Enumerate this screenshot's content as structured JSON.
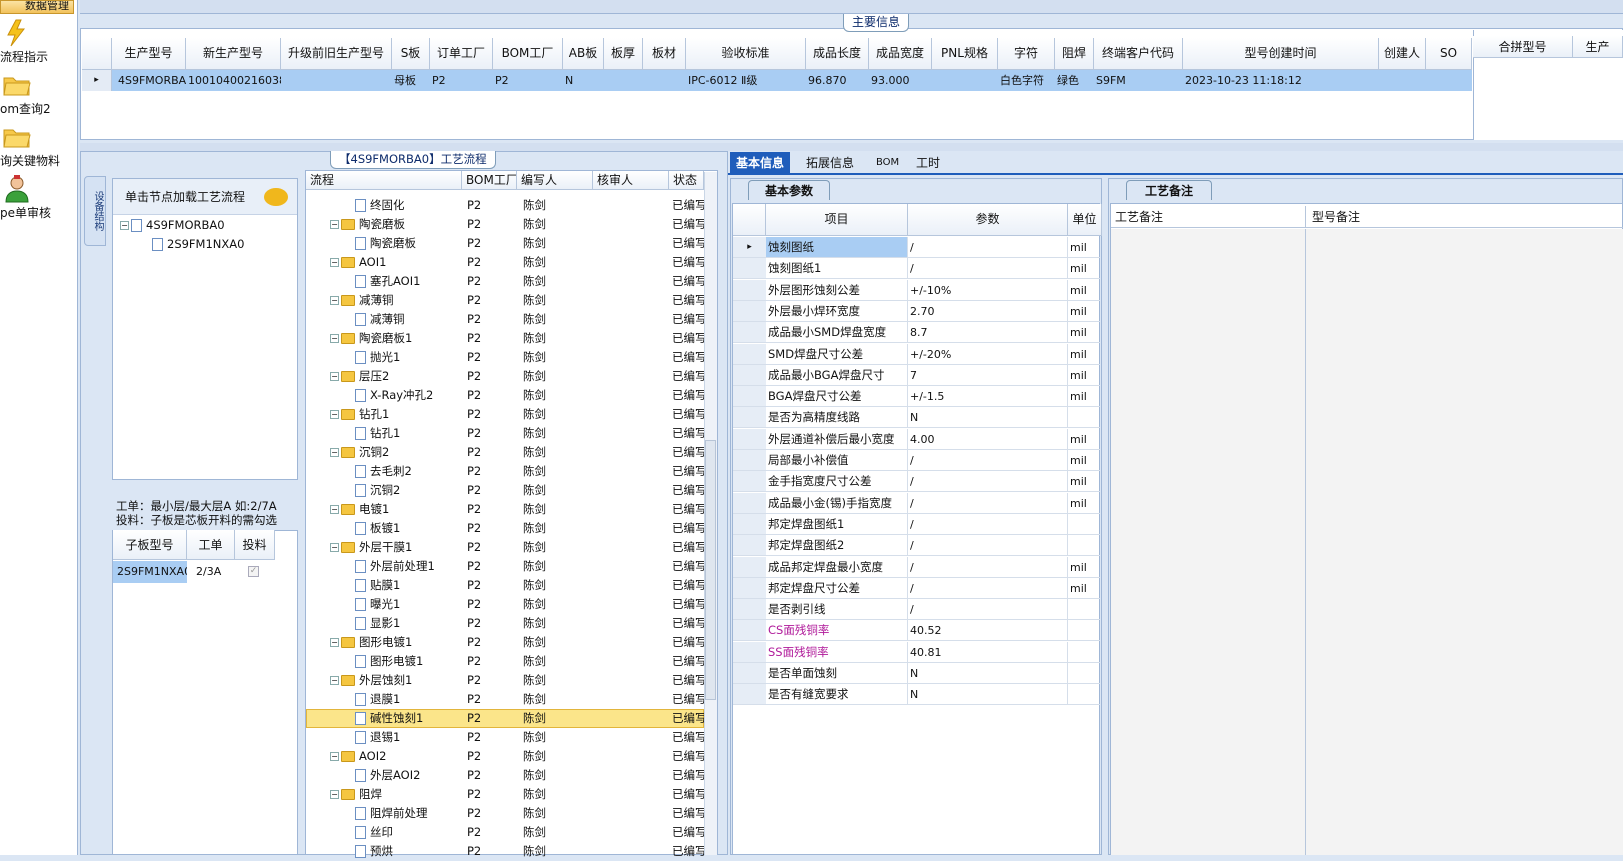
{
  "sidebar": {
    "header": "数据管理",
    "items": [
      {
        "label": "流程指示",
        "icon": "lightning-icon"
      },
      {
        "label": "om查询2",
        "icon": "folder-icon"
      },
      {
        "label": "询关键物料",
        "icon": "folder-icon"
      },
      {
        "label": "pe单审核",
        "icon": "user-icon"
      }
    ]
  },
  "main_info": {
    "title": "主要信息",
    "columns": [
      "生产型号",
      "新生产型号",
      "升级前旧生产型号",
      "S板",
      "订单工厂",
      "BOM工厂",
      "AB板",
      "板厚",
      "板材",
      "验收标准",
      "成品长度",
      "成品宽度",
      "PNL规格",
      "字符",
      "阻焊",
      "终端客户代码",
      "型号创建时间",
      "创建人",
      "SO"
    ],
    "row": {
      "prod_model": "4S9FMORBA0",
      "new_model": "10010400216038",
      "s_board": "母板",
      "order_factory": "P2",
      "bom_factory": "P2",
      "ab_board": "N",
      "standard": "IPC-6012 Ⅱ级",
      "length": "96.870",
      "width": "93.000",
      "char": "白色字符",
      "solder": "绿色",
      "customer": "S9FM",
      "created": "2023-10-23 11:18:12"
    },
    "right_columns": [
      "合拼型号",
      "生产"
    ]
  },
  "flow": {
    "title": "【4S9FMORBA0】工艺流程",
    "side_tab": "设备结构",
    "hint": "单击节点加载工艺流程",
    "tree": [
      "4S9FMORBA0",
      "2S9FM1NXA0"
    ],
    "note1": "工单：最小层/最大层A 如:2/7A",
    "note2": "投料：子板是芯板开料的需勾选",
    "sub_headers": [
      "子板型号",
      "工单",
      "投料"
    ],
    "sub_row": {
      "model": "2S9FM1NXA0",
      "order": "2/3A"
    },
    "cols": [
      "流程",
      "BOM工厂",
      "编写人",
      "核审人",
      "状态"
    ],
    "steps": [
      {
        "name": "终固化",
        "f": "P2",
        "w": "陈剑",
        "st": "已编写",
        "lvl": 2
      },
      {
        "name": "陶瓷磨板",
        "f": "P2",
        "w": "陈剑",
        "st": "已编写",
        "lvl": 1
      },
      {
        "name": "陶瓷磨板",
        "f": "P2",
        "w": "陈剑",
        "st": "已编写",
        "lvl": 2
      },
      {
        "name": "AOI1",
        "f": "P2",
        "w": "陈剑",
        "st": "已编写",
        "lvl": 1
      },
      {
        "name": "塞孔AOI1",
        "f": "P2",
        "w": "陈剑",
        "st": "已编写",
        "lvl": 2
      },
      {
        "name": "减薄铜",
        "f": "P2",
        "w": "陈剑",
        "st": "已编写",
        "lvl": 1
      },
      {
        "name": "减薄铜",
        "f": "P2",
        "w": "陈剑",
        "st": "已编写",
        "lvl": 2
      },
      {
        "name": "陶瓷磨板1",
        "f": "P2",
        "w": "陈剑",
        "st": "已编写",
        "lvl": 1
      },
      {
        "name": "抛光1",
        "f": "P2",
        "w": "陈剑",
        "st": "已编写",
        "lvl": 2
      },
      {
        "name": "层压2",
        "f": "P2",
        "w": "陈剑",
        "st": "已编写",
        "lvl": 1
      },
      {
        "name": "X-Ray冲孔2",
        "f": "P2",
        "w": "陈剑",
        "st": "已编写",
        "lvl": 2
      },
      {
        "name": "钻孔1",
        "f": "P2",
        "w": "陈剑",
        "st": "已编写",
        "lvl": 1
      },
      {
        "name": "钻孔1",
        "f": "P2",
        "w": "陈剑",
        "st": "已编写",
        "lvl": 2
      },
      {
        "name": "沉铜2",
        "f": "P2",
        "w": "陈剑",
        "st": "已编写",
        "lvl": 1
      },
      {
        "name": "去毛刺2",
        "f": "P2",
        "w": "陈剑",
        "st": "已编写",
        "lvl": 2
      },
      {
        "name": "沉铜2",
        "f": "P2",
        "w": "陈剑",
        "st": "已编写",
        "lvl": 2
      },
      {
        "name": "电镀1",
        "f": "P2",
        "w": "陈剑",
        "st": "已编写",
        "lvl": 1
      },
      {
        "name": "板镀1",
        "f": "P2",
        "w": "陈剑",
        "st": "已编写",
        "lvl": 2
      },
      {
        "name": "外层干膜1",
        "f": "P2",
        "w": "陈剑",
        "st": "已编写",
        "lvl": 1
      },
      {
        "name": "外层前处理1",
        "f": "P2",
        "w": "陈剑",
        "st": "已编写",
        "lvl": 2
      },
      {
        "name": "贴膜1",
        "f": "P2",
        "w": "陈剑",
        "st": "已编写",
        "lvl": 2
      },
      {
        "name": "曝光1",
        "f": "P2",
        "w": "陈剑",
        "st": "已编写",
        "lvl": 2
      },
      {
        "name": "显影1",
        "f": "P2",
        "w": "陈剑",
        "st": "已编写",
        "lvl": 2
      },
      {
        "name": "图形电镀1",
        "f": "P2",
        "w": "陈剑",
        "st": "已编写",
        "lvl": 1
      },
      {
        "name": "图形电镀1",
        "f": "P2",
        "w": "陈剑",
        "st": "已编写",
        "lvl": 2
      },
      {
        "name": "外层蚀刻1",
        "f": "P2",
        "w": "陈剑",
        "st": "已编写",
        "lvl": 1
      },
      {
        "name": "退膜1",
        "f": "P2",
        "w": "陈剑",
        "st": "已编写",
        "lvl": 2
      },
      {
        "name": "碱性蚀刻1",
        "f": "P2",
        "w": "陈剑",
        "st": "已编写",
        "lvl": 2,
        "sel": true
      },
      {
        "name": "退锡1",
        "f": "P2",
        "w": "陈剑",
        "st": "已编写",
        "lvl": 2
      },
      {
        "name": "AOI2",
        "f": "P2",
        "w": "陈剑",
        "st": "已编写",
        "lvl": 1
      },
      {
        "name": "外层AOI2",
        "f": "P2",
        "w": "陈剑",
        "st": "已编写",
        "lvl": 2
      },
      {
        "name": "阻焊",
        "f": "P2",
        "w": "陈剑",
        "st": "已编写",
        "lvl": 1
      },
      {
        "name": "阻焊前处理",
        "f": "P2",
        "w": "陈剑",
        "st": "已编写",
        "lvl": 2
      },
      {
        "name": "丝印",
        "f": "P2",
        "w": "陈剑",
        "st": "已编写",
        "lvl": 2
      },
      {
        "name": "预烘",
        "f": "P2",
        "w": "陈剑",
        "st": "已编写",
        "lvl": 2
      }
    ]
  },
  "tabs": [
    "基本信息",
    "拓展信息",
    "BOM",
    "工时"
  ],
  "params": {
    "tab": "基本参数",
    "headers": [
      "项目",
      "参数",
      "单位"
    ],
    "rows": [
      {
        "k": "蚀刻图纸",
        "v": "/",
        "u": "mil"
      },
      {
        "k": "蚀刻图纸1",
        "v": "/",
        "u": "mil"
      },
      {
        "k": "外层图形蚀刻公差",
        "v": "+/-10%",
        "u": "mil"
      },
      {
        "k": "外层最小焊环宽度",
        "v": "2.70",
        "u": "mil"
      },
      {
        "k": "成品最小SMD焊盘宽度",
        "v": "8.7",
        "u": "mil"
      },
      {
        "k": "SMD焊盘尺寸公差",
        "v": "+/-20%",
        "u": "mil"
      },
      {
        "k": "成品最小BGA焊盘尺寸",
        "v": "7",
        "u": "mil"
      },
      {
        "k": "BGA焊盘尺寸公差",
        "v": "+/-1.5",
        "u": "mil"
      },
      {
        "k": "是否为高精度线路",
        "v": "N",
        "u": ""
      },
      {
        "k": "外层通道补偿后最小宽度",
        "v": "4.00",
        "u": "mil"
      },
      {
        "k": "局部最小补偿值",
        "v": "/",
        "u": "mil"
      },
      {
        "k": "金手指宽度尺寸公差",
        "v": "/",
        "u": "mil"
      },
      {
        "k": "成品最小金(锡)手指宽度",
        "v": "/",
        "u": "mil"
      },
      {
        "k": "邦定焊盘图纸1",
        "v": "/",
        "u": ""
      },
      {
        "k": "邦定焊盘图纸2",
        "v": "/",
        "u": ""
      },
      {
        "k": "成品邦定焊盘最小宽度",
        "v": "/",
        "u": "mil"
      },
      {
        "k": "邦定焊盘尺寸公差",
        "v": "/",
        "u": "mil"
      },
      {
        "k": "是否剥引线",
        "v": "/",
        "u": ""
      },
      {
        "k": "CS面残铜率",
        "v": "40.52",
        "u": "",
        "pink": true
      },
      {
        "k": "SS面残铜率",
        "v": "40.81",
        "u": "",
        "pink": true
      },
      {
        "k": "是否单面蚀刻",
        "v": "N",
        "u": ""
      },
      {
        "k": "是否有缝宽要求",
        "v": "N",
        "u": ""
      }
    ]
  },
  "remarks": {
    "tab": "工艺备注",
    "col1": "工艺备注",
    "col2": "型号备注"
  }
}
